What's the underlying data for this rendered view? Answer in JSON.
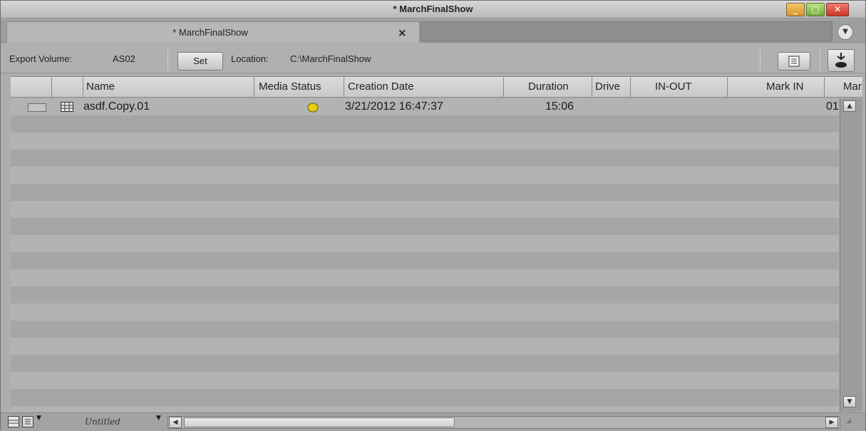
{
  "window": {
    "title": "* MarchFinalShow",
    "controls": {
      "minimize": "_",
      "maximize": "□",
      "close": "✕"
    }
  },
  "tab": {
    "label": "* MarchFinalShow",
    "close_icon": "×"
  },
  "toolbar": {
    "export_volume_label": "Export Volume:",
    "export_volume_value": "AS02",
    "set_label": "Set",
    "location_label": "Location:",
    "location_value": "C:\\MarchFinalShow"
  },
  "columns": [
    "Name",
    "Media Status",
    "Creation Date",
    "Duration",
    "Drive",
    "IN-OUT",
    "Mark IN",
    "Mark"
  ],
  "rows": [
    {
      "name": "asdf.Copy.01",
      "media_status_color": "#e6cf12",
      "creation_date": "3/21/2012 16:47:37",
      "duration": "15:06",
      "mark_in_clip": "01"
    }
  ],
  "statusbar": {
    "view_name": "Untitled"
  },
  "icons": {
    "tab_menu": "chevron-down-circle-icon",
    "list_view": "list-view-icon",
    "hand": "hand-icon"
  }
}
